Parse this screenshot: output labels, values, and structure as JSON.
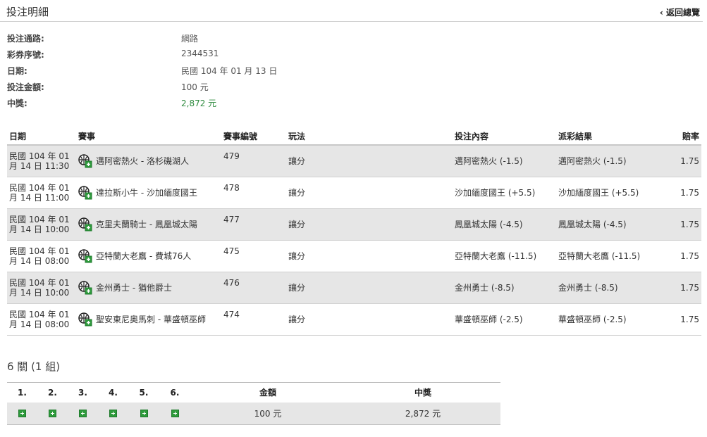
{
  "header": {
    "title": "投注明細",
    "back_label": "‹ 返回總覽"
  },
  "info": [
    {
      "label": "投注通路:",
      "value": "網路"
    },
    {
      "label": "彩券序號:",
      "value": "2344531"
    },
    {
      "label": "日期:",
      "value": "民國 104 年 01 月 13 日"
    },
    {
      "label": "投注金額:",
      "value": "100 元"
    },
    {
      "label": "中獎:",
      "value": "2,872 元",
      "color": "#2e8b3e"
    }
  ],
  "bets": {
    "headers": [
      "日期",
      "賽事",
      "賽事編號",
      "玩法",
      "投注內容",
      "派彩結果",
      "賠率"
    ],
    "sport_icon": "basketball-icon",
    "rows": [
      {
        "date1": "民國 104 年 01",
        "date2": "月 14 日 11:30",
        "event": "邁阿密熱火 - 洛杉磯湖人",
        "number": "479",
        "play": "讓分",
        "pick": "邁阿密熱火 (-1.5)",
        "result": "邁阿密熱火 (-1.5)",
        "odds": "1.75"
      },
      {
        "date1": "民國 104 年 01",
        "date2": "月 14 日 11:00",
        "event": "達拉斯小牛 - 沙加緬度國王",
        "number": "478",
        "play": "讓分",
        "pick": "沙加緬度國王 (+5.5)",
        "result": "沙加緬度國王 (+5.5)",
        "odds": "1.75"
      },
      {
        "date1": "民國 104 年 01",
        "date2": "月 14 日 10:00",
        "event": "克里夫蘭騎士 - 鳳凰城太陽",
        "number": "477",
        "play": "讓分",
        "pick": "鳳凰城太陽 (-4.5)",
        "result": "鳳凰城太陽 (-4.5)",
        "odds": "1.75"
      },
      {
        "date1": "民國 104 年 01",
        "date2": "月 14 日 08:00",
        "event": "亞特蘭大老鷹 - 費城76人",
        "number": "475",
        "play": "讓分",
        "pick": "亞特蘭大老鷹 (-11.5)",
        "result": "亞特蘭大老鷹 (-11.5)",
        "odds": "1.75"
      },
      {
        "date1": "民國 104 年 01",
        "date2": "月 14 日 10:00",
        "event": "金州勇士 - 猶他爵士",
        "number": "476",
        "play": "讓分",
        "pick": "金州勇士 (-8.5)",
        "result": "金州勇士 (-8.5)",
        "odds": "1.75"
      },
      {
        "date1": "民國 104 年 01",
        "date2": "月 14 日 08:00",
        "event": "聖安東尼奧馬刺 - 華盛頓巫師",
        "number": "474",
        "play": "讓分",
        "pick": "華盛頓巫師 (-2.5)",
        "result": "華盛頓巫師 (-2.5)",
        "odds": "1.75"
      }
    ]
  },
  "parlay": {
    "title": "6 關 (1 組)",
    "legs": [
      "1.",
      "2.",
      "3.",
      "4.",
      "5.",
      "6."
    ],
    "amount_header": "金額",
    "win_header": "中獎",
    "amount": "100 元",
    "win": "2,872 元",
    "leg_icon": "plus-icon"
  },
  "colors": {
    "accent_green": "#2e9a3c",
    "win_text": "#2e8b3e",
    "row_shade": "#e6e6e6"
  }
}
